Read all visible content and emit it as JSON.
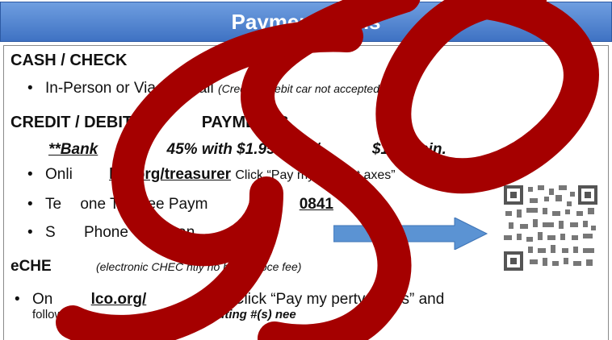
{
  "header": {
    "title": "Paymen   ptions"
  },
  "sections": {
    "cash": {
      "heading": "CASH / CHECK",
      "item_main": "In-Person or Via US Mail",
      "item_note": "(Credit or debit car       not accepted)"
    },
    "card": {
      "heading": "CREDIT / DEBIT",
      "heading_tail": "PAYMENTS",
      "fee_lead": "**Bank",
      "fee_mid": "45% with $1.95 min. /",
      "fee_tail": "$1.00 min.",
      "online_prefix": "Onli",
      "online_link": "lco.org/treasurer",
      "online_action": "Click “Pay my Propert   axes”",
      "phone_prefix": "Te",
      "phone_mid": "one Toll-free Paym",
      "phone_number": "0841",
      "qr_prefix": "S",
      "qr_text": "Phone QR Scan"
    },
    "echeck": {
      "heading": "eCHE",
      "note": "(electronic CHEC        ntly no bank proce     fee)",
      "online_prefix": "On",
      "online_link": "lco.org/",
      "online_link_tail": "rer",
      "online_action": "- Click “Pay my     perty Taxes” and",
      "follow_prefix": "follow",
      "follow_tail": "ount & routing #(s) nee"
    }
  },
  "colors": {
    "header_top": "#6f9ee0",
    "header_bottom": "#3f72c3",
    "arrow": "#5b93d3",
    "scribble": "#a50000"
  },
  "icons": {
    "bullet": "•",
    "arrow": "right-arrow-icon",
    "qr": "qr-code-icon"
  }
}
